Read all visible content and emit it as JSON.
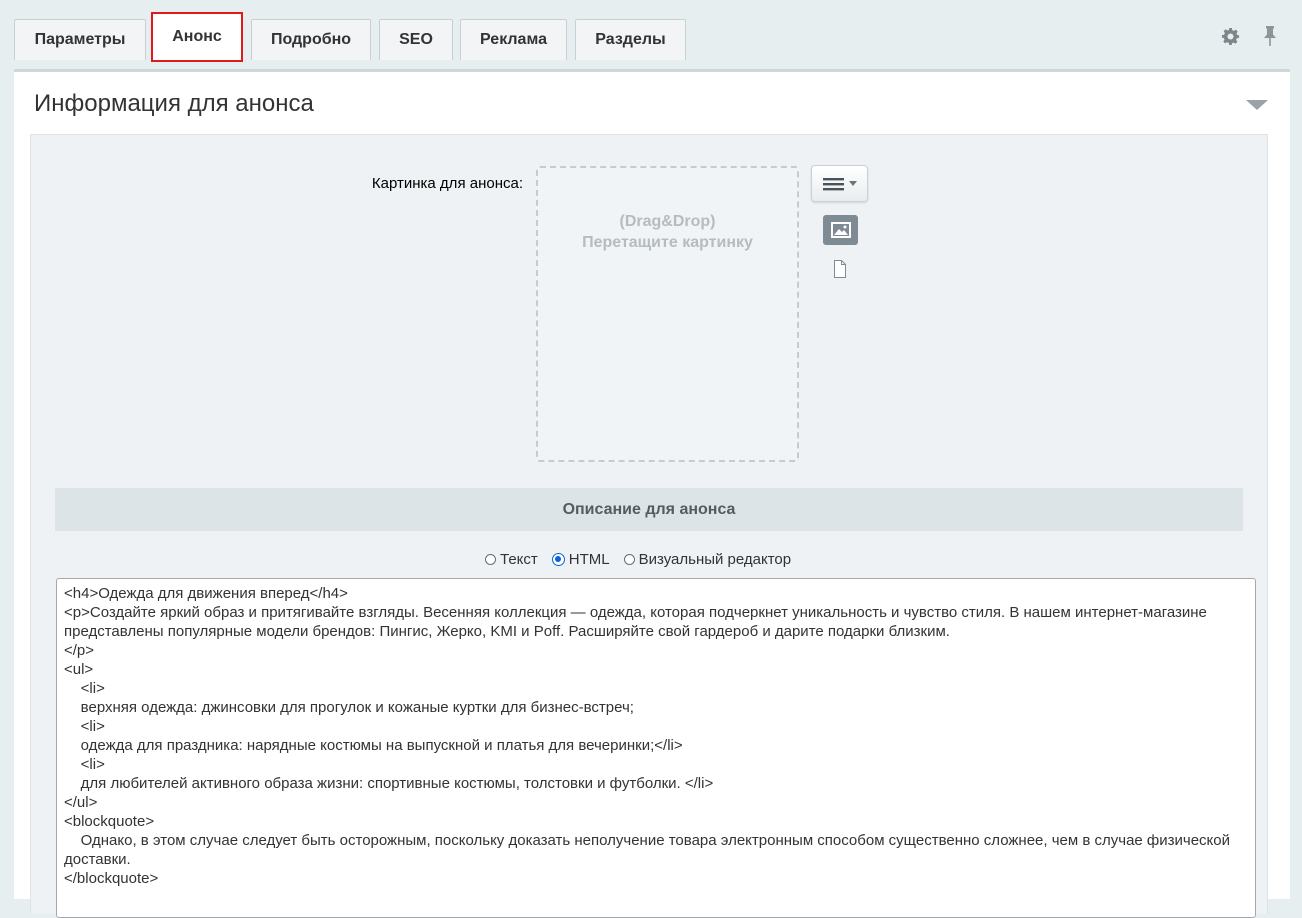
{
  "tabs": [
    {
      "label": "Параметры",
      "active": false
    },
    {
      "label": "Анонс",
      "active": true
    },
    {
      "label": "Подробно",
      "active": false
    },
    {
      "label": "SEO",
      "active": false
    },
    {
      "label": "Реклама",
      "active": false
    },
    {
      "label": "Разделы",
      "active": false
    }
  ],
  "tools": {
    "settings_icon": "gear-icon",
    "pin_icon": "pin-icon"
  },
  "section": {
    "title": "Информация для анонса"
  },
  "image_field": {
    "label": "Картинка для анонса:",
    "dropzone_line1": "(Drag&Drop)",
    "dropzone_line2": "Перетащите картинку"
  },
  "description": {
    "header": "Описание для анонса",
    "modes": [
      {
        "label": "Текст",
        "checked": false
      },
      {
        "label": "HTML",
        "checked": true
      },
      {
        "label": "Визуальный редактор",
        "checked": false
      }
    ],
    "content": "<h4>Одежда для движения вперед</h4>\n<p>Создайте яркий образ и притягивайте взгляды. Весенняя коллекция — одежда, которая подчеркнет уникальность и чувство стиля. В нашем интернет-магазине представлены популярные модели брендов: Пингис, Жерко, KMI и Poff. Расширяйте свой гардероб и дарите подарки близким.\n</p>\n<ul>\n\t<li>\n\tверхняя одежда: джинсовки для прогулок и кожаные куртки для бизнес-встреч;\n\t<li>\n\tодежда для праздника: нарядные костюмы на выпускной и платья для вечеринки;</li>\n\t<li>\n\tдля любителей активного образа жизни: спортивные костюмы, толстовки и футболки. </li>\n</ul>\n<blockquote>\n\tОднако, в этом случае следует быть осторожным, поскольку доказать неполучение товара электронным способом существенно сложнее, чем в случае физической доставки.\n</blockquote>"
  },
  "colors": {
    "active_tab_border": "#e01a1a",
    "radio_accent": "#0a64d8"
  }
}
